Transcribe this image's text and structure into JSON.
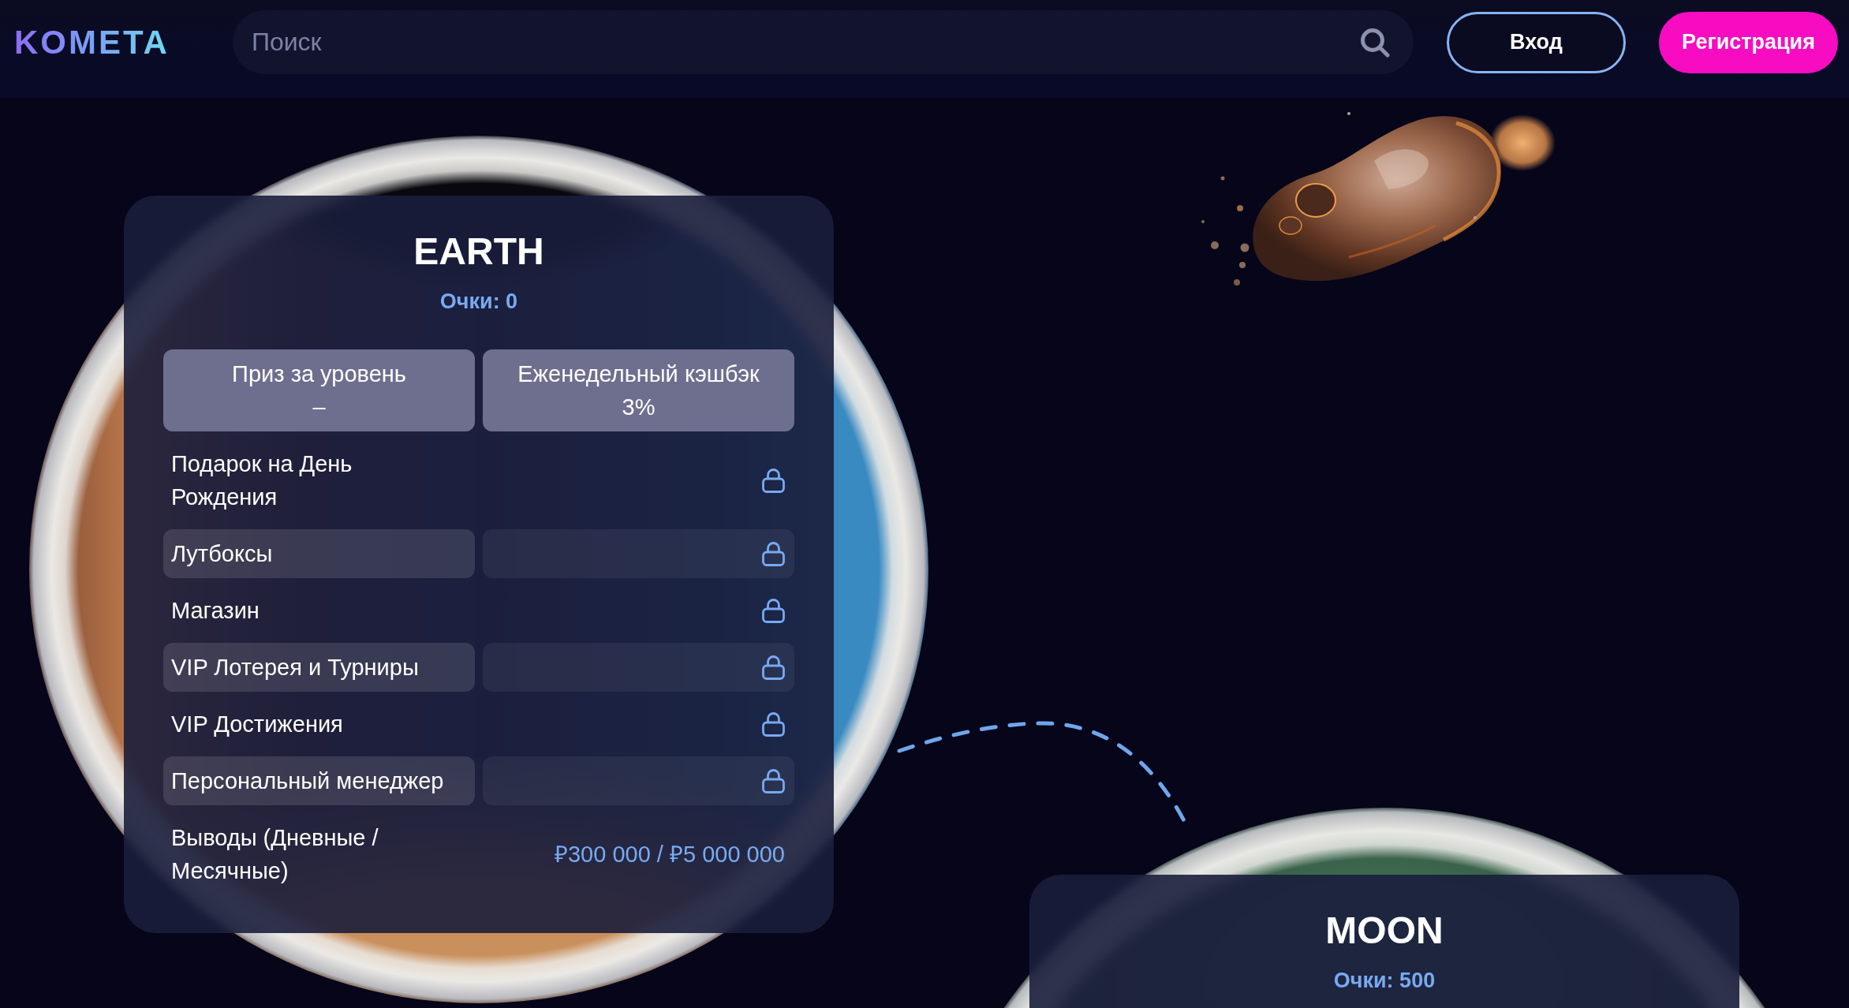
{
  "header": {
    "logo": "KOMETA",
    "search": {
      "placeholder": "Поиск"
    },
    "buttons": [
      {
        "label": "Вход",
        "kind": "outline"
      },
      {
        "label": "Регистрация",
        "kind": "filled"
      }
    ]
  },
  "levels": [
    {
      "kind": "earth",
      "title": "EARTH",
      "points": "Очки: 0",
      "rewards": [
        {
          "label": "Приз за уровень",
          "value": "–"
        },
        {
          "label": "Еженедельный кэшбэк",
          "value": "3%"
        }
      ],
      "rows": [
        {
          "label": "Подарок на День Рождения",
          "locked": true
        },
        {
          "label": "Лутбоксы",
          "locked": true
        },
        {
          "label": "Магазин",
          "locked": true
        },
        {
          "label": "VIP Лотерея и Турниры",
          "locked": true
        },
        {
          "label": "VIP Достижения",
          "locked": true
        },
        {
          "label": "Персональный менеджер",
          "locked": true
        },
        {
          "label": "Выводы (Дневные / Месячные)",
          "locked": false,
          "value": "₽300 000 / ₽5 000 000"
        }
      ]
    },
    {
      "kind": "moon",
      "title": "MOON",
      "points": "Очки: 500"
    }
  ]
}
